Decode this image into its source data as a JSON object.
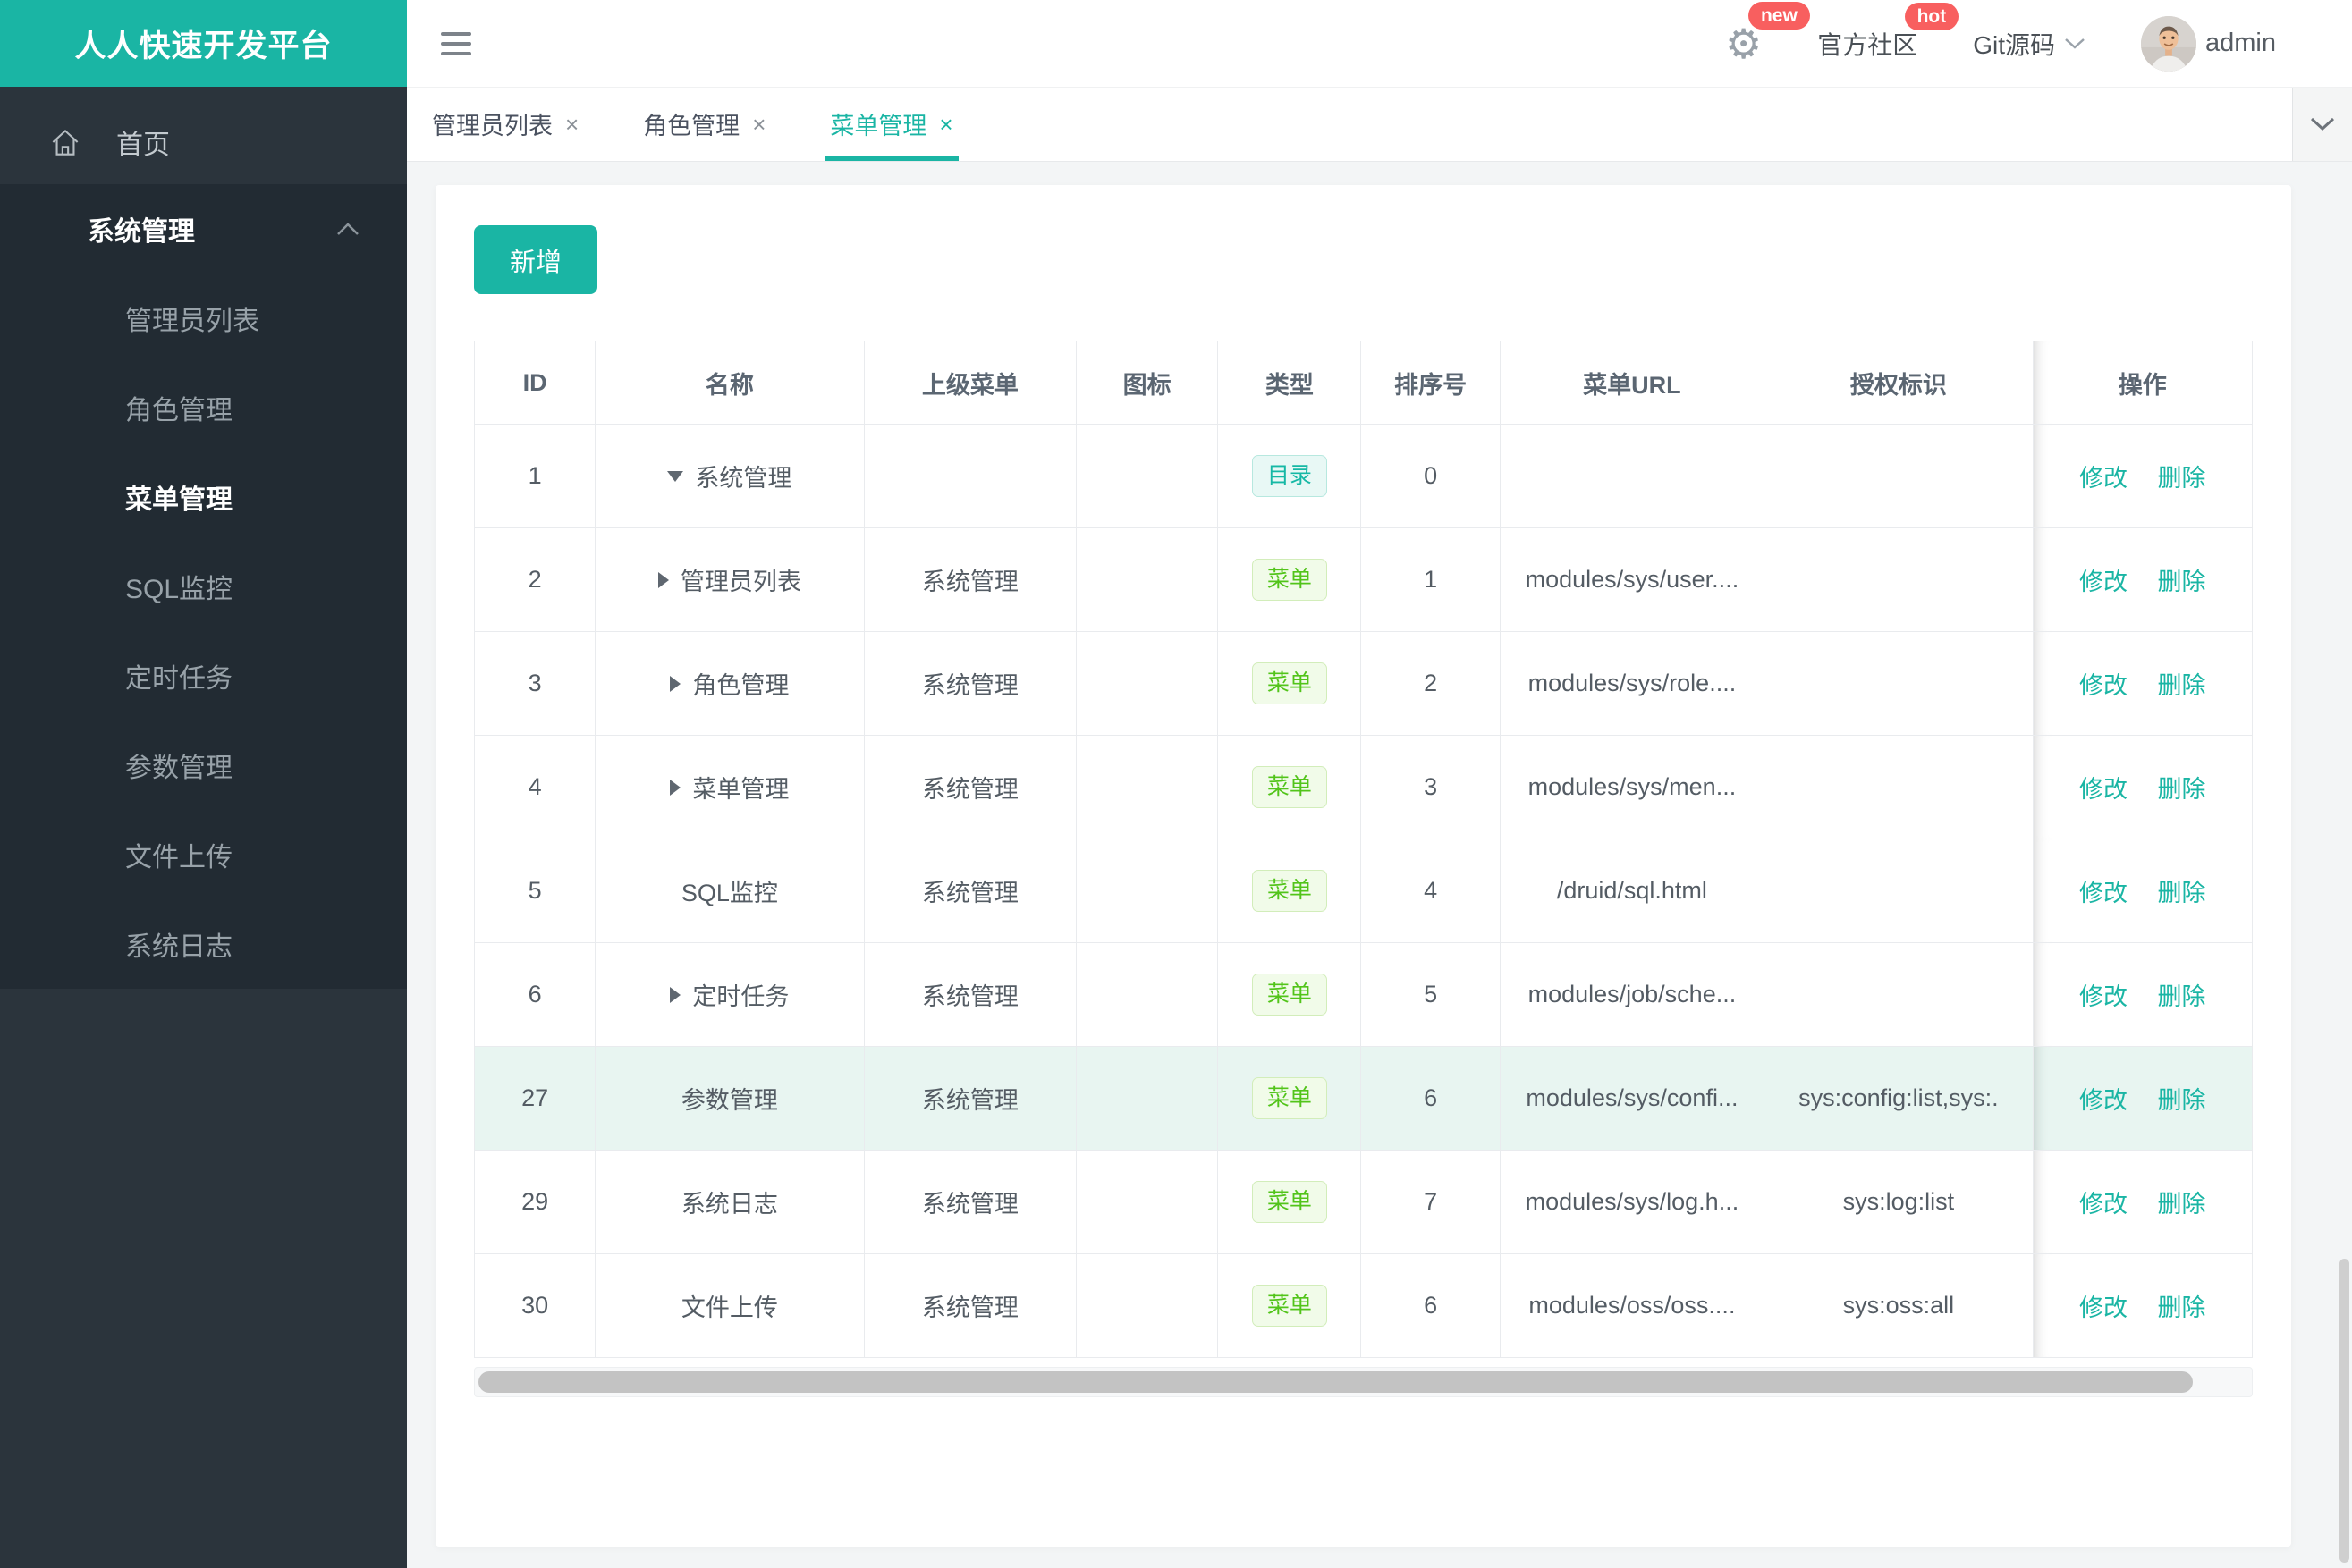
{
  "app": {
    "logo": "人人快速开发平台"
  },
  "header": {
    "community_label": "官方社区",
    "git_label": "Git源码",
    "user": "admin",
    "badges": {
      "new": "new",
      "hot": "hot"
    }
  },
  "sidebar": {
    "home_label": "首页",
    "group": {
      "label": "系统管理",
      "active_index": 2,
      "items": [
        "管理员列表",
        "角色管理",
        "菜单管理",
        "SQL监控",
        "定时任务",
        "参数管理",
        "文件上传",
        "系统日志"
      ]
    }
  },
  "tabs": [
    {
      "label": "管理员列表",
      "close_label": "×",
      "active": false
    },
    {
      "label": "角色管理",
      "close_label": "×",
      "active": false
    },
    {
      "label": "菜单管理",
      "close_label": "×",
      "active": true
    }
  ],
  "toolbar": {
    "add_label": "新增"
  },
  "table": {
    "columns": [
      "ID",
      "名称",
      "上级菜单",
      "图标",
      "类型",
      "排序号",
      "菜单URL",
      "授权标识",
      "操作"
    ],
    "action_labels": [
      "修改",
      "删除"
    ],
    "rows": [
      {
        "id": "1",
        "arrow": "down",
        "name": "系统管理",
        "parent": "",
        "icon": "",
        "type": "dir",
        "type_label": "目录",
        "sort": "0",
        "url": "",
        "perm": "",
        "highlighted": false
      },
      {
        "id": "2",
        "arrow": "right",
        "name": "管理员列表",
        "parent": "系统管理",
        "icon": "",
        "type": "menu",
        "type_label": "菜单",
        "sort": "1",
        "url": "modules/sys/user....",
        "perm": "",
        "highlighted": false
      },
      {
        "id": "3",
        "arrow": "right",
        "name": "角色管理",
        "parent": "系统管理",
        "icon": "",
        "type": "menu",
        "type_label": "菜单",
        "sort": "2",
        "url": "modules/sys/role....",
        "perm": "",
        "highlighted": false
      },
      {
        "id": "4",
        "arrow": "right",
        "name": "菜单管理",
        "parent": "系统管理",
        "icon": "",
        "type": "menu",
        "type_label": "菜单",
        "sort": "3",
        "url": "modules/sys/men...",
        "perm": "",
        "highlighted": false
      },
      {
        "id": "5",
        "arrow": "",
        "name": "SQL监控",
        "parent": "系统管理",
        "icon": "",
        "type": "menu",
        "type_label": "菜单",
        "sort": "4",
        "url": "/druid/sql.html",
        "perm": "",
        "highlighted": false
      },
      {
        "id": "6",
        "arrow": "right",
        "name": "定时任务",
        "parent": "系统管理",
        "icon": "",
        "type": "menu",
        "type_label": "菜单",
        "sort": "5",
        "url": "modules/job/sche...",
        "perm": "",
        "highlighted": false
      },
      {
        "id": "27",
        "arrow": "",
        "name": "参数管理",
        "parent": "系统管理",
        "icon": "",
        "type": "menu",
        "type_label": "菜单",
        "sort": "6",
        "url": "modules/sys/confi...",
        "perm": "sys:config:list,sys:.",
        "highlighted": true
      },
      {
        "id": "29",
        "arrow": "",
        "name": "系统日志",
        "parent": "系统管理",
        "icon": "",
        "type": "menu",
        "type_label": "菜单",
        "sort": "7",
        "url": "modules/sys/log.h...",
        "perm": "sys:log:list",
        "highlighted": false
      },
      {
        "id": "30",
        "arrow": "",
        "name": "文件上传",
        "parent": "系统管理",
        "icon": "",
        "type": "menu",
        "type_label": "菜单",
        "sort": "6",
        "url": "modules/oss/oss....",
        "perm": "sys:oss:all",
        "highlighted": false
      }
    ]
  },
  "colors": {
    "accent": "#1ab5a4",
    "badge_red": "#f85f5f",
    "menu_green": "#52c41a",
    "dir_teal": "#16b8a5",
    "row_highlight": "#e8f5f1"
  }
}
